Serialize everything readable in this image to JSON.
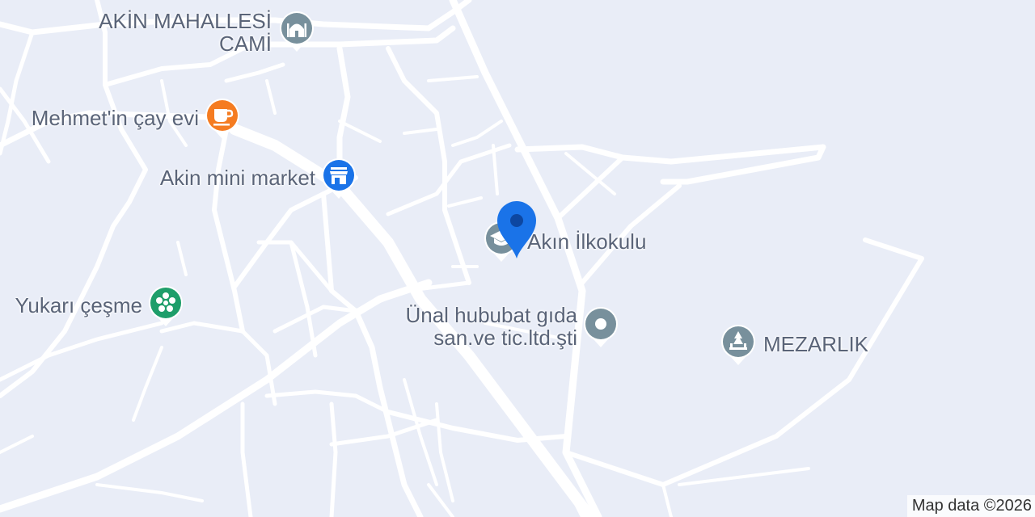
{
  "map": {
    "attribution": "Map data ©2026",
    "colors": {
      "land": "#e9edf7",
      "road": "#ffffff",
      "pin_blue": "#1a73e8",
      "poi_gray": "#78909c",
      "poi_orange": "#f57c21",
      "poi_green": "#1e9e6a",
      "label": "#5a6478"
    },
    "pois": [
      {
        "name_line1": "AKİN MAHALLESİ",
        "name_line2": "CAMİ",
        "icon": "mosque-icon"
      },
      {
        "name": "Mehmet'in çay evi",
        "icon": "coffee-cup-icon"
      },
      {
        "name": "Akin mini market",
        "icon": "store-icon"
      },
      {
        "name": "Yukarı çeşme",
        "icon": "fountain-icon"
      },
      {
        "name": "Akın İlkokulu",
        "icon": "school-icon"
      },
      {
        "name_line1": "Ünal hububat gıda",
        "name_line2": "san.ve tic.ltd.şti",
        "icon": "place-icon"
      },
      {
        "name": "MEZARLIK",
        "icon": "cemetery-icon"
      }
    ],
    "location_marker": {
      "icon": "location-pin-icon"
    }
  }
}
